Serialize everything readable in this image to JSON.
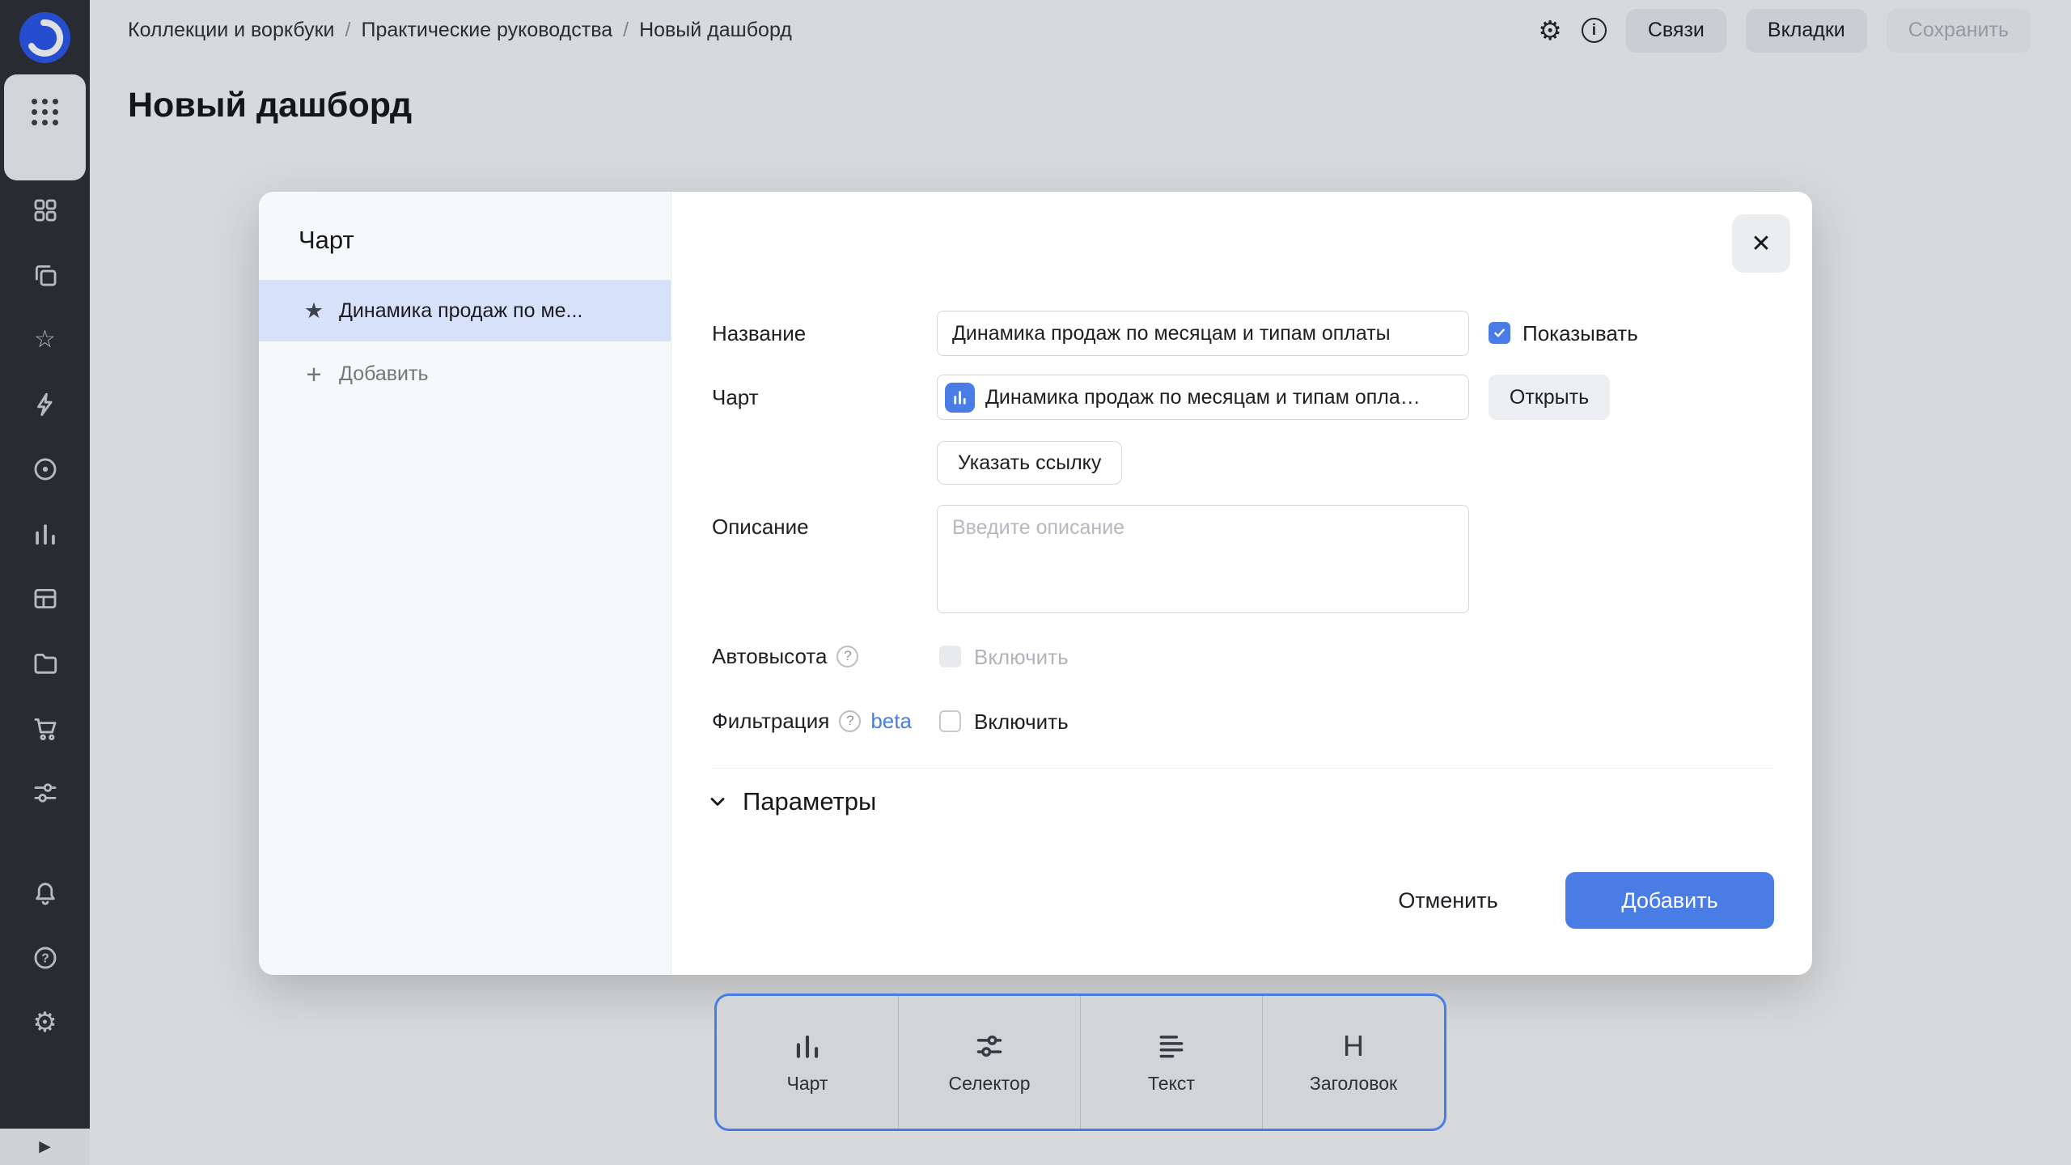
{
  "colors": {
    "accent": "#4a7ce6",
    "selected_bg": "#d8e1fa"
  },
  "glyphs": {
    "close": "✕",
    "star_filled": "★",
    "star_outline": "☆",
    "plus": "+",
    "question": "?",
    "gear": "⚙",
    "play": "▶",
    "info": "i",
    "heading": "H"
  },
  "sidebar": {
    "icons": [
      "dashboards-icon",
      "collections-icon",
      "favorites-icon",
      "editor-icon",
      "datasets-icon",
      "charts-icon",
      "tables-icon",
      "files-icon",
      "marketplace-icon",
      "services-icon",
      "notifications-icon",
      "help-icon",
      "settings-icon",
      "expand-icon"
    ]
  },
  "header": {
    "breadcrumb": [
      "Коллекции и воркбуки",
      "Практические руководства",
      "Новый дашборд"
    ],
    "breadcrumb_separator": "/",
    "actions": {
      "connections": "Связи",
      "tabs": "Вкладки",
      "save": "Сохранить"
    }
  },
  "page": {
    "title": "Новый дашборд"
  },
  "modal": {
    "panel": {
      "title": "Чарт",
      "items": [
        {
          "label": "Динамика продаж по ме..."
        }
      ],
      "add_label": "Добавить"
    },
    "form": {
      "name_label": "Название",
      "name_value": "Динамика продаж по месяцам и типам оплаты",
      "show_checkbox_label": "Показывать",
      "chart_label": "Чарт",
      "chart_value": "Динамика продаж по месяцам и типам опла…",
      "open_button": "Открыть",
      "link_button": "Указать ссылку",
      "description_label": "Описание",
      "description_placeholder": "Введите описание",
      "autoheight_label": "Автовысота",
      "autoheight_checkbox_label": "Включить",
      "filtering_label": "Фильтрация",
      "filtering_beta": "beta",
      "filtering_checkbox_label": "Включить",
      "params_section": "Параметры"
    },
    "footer": {
      "cancel": "Отменить",
      "submit": "Добавить"
    }
  },
  "toolbar": {
    "items": [
      {
        "label": "Чарт"
      },
      {
        "label": "Селектор"
      },
      {
        "label": "Текст"
      },
      {
        "label": "Заголовок"
      }
    ]
  }
}
